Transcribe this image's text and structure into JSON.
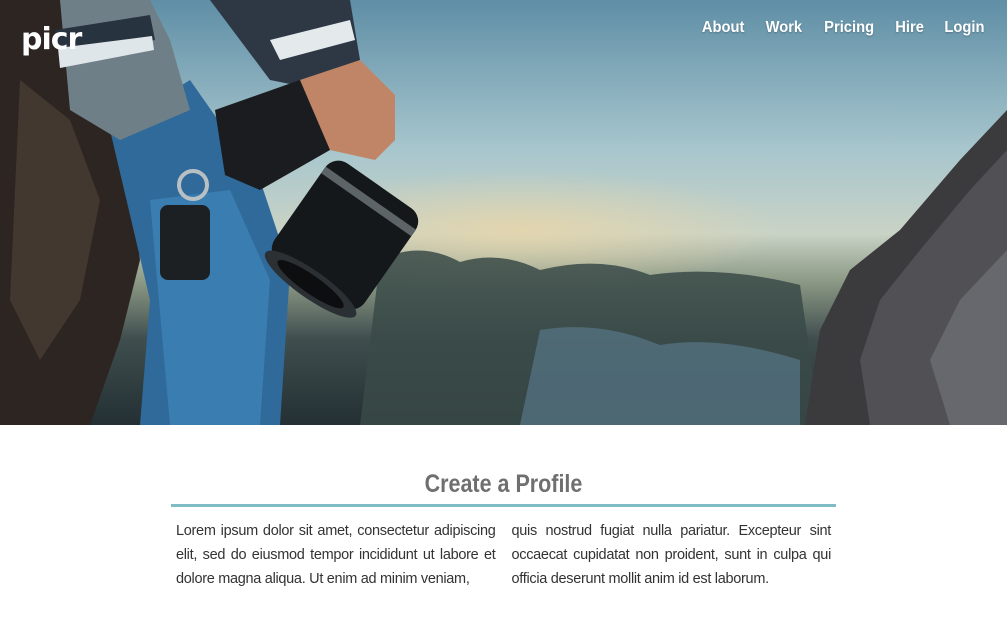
{
  "header": {
    "logo": "picr",
    "nav": [
      "About",
      "Work",
      "Pricing",
      "Hire",
      "Login"
    ]
  },
  "main": {
    "title": "Create a Profile",
    "col1": "Lorem ipsum dolor sit amet, consectetur adipiscing elit, sed do eiusmod tempor incididunt ut labore et dolore magna aliqua. Ut enim ad minim veniam,",
    "col2": "quis nostrud fugiat nulla pariatur. Excepteur sint occaecat cupidatat non proident, sunt in culpa qui officia deserunt mollit anim id est laborum."
  },
  "colors": {
    "accent_rule": "#7fbcc6",
    "title_text": "#6f6f6f",
    "body_text": "#333333"
  }
}
